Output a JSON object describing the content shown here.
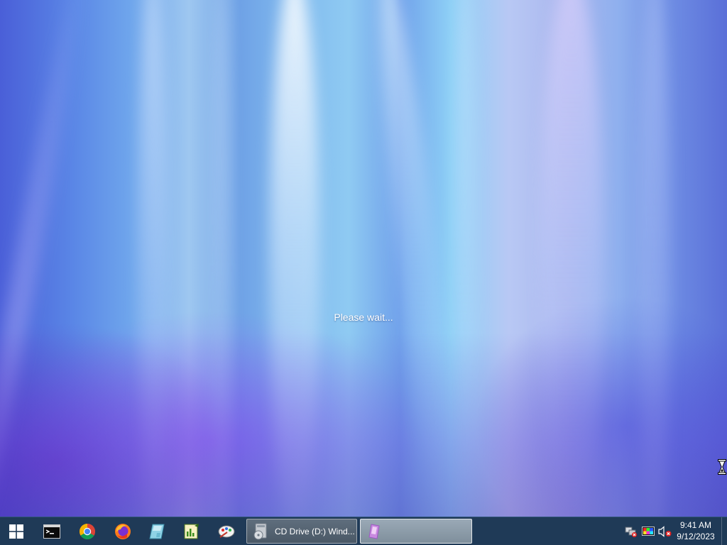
{
  "desktop": {
    "status_message": "Please wait..."
  },
  "taskbar": {
    "start_icon": "windows-logo-icon",
    "pinned": [
      {
        "name": "command-prompt",
        "icon": "terminal-icon"
      },
      {
        "name": "google-chrome",
        "icon": "chrome-icon"
      },
      {
        "name": "firefox",
        "icon": "firefox-icon"
      },
      {
        "name": "app-4",
        "icon": "glass-panel-icon"
      },
      {
        "name": "app-5",
        "icon": "chart-notepad-icon"
      },
      {
        "name": "app-6",
        "icon": "paint-palette-icon"
      }
    ],
    "tasks": [
      {
        "label": "CD Drive (D:) Wind...",
        "icon": "cd-drive-icon",
        "active": false
      },
      {
        "label": "",
        "icon": "media-player-icon",
        "active": true
      }
    ],
    "tray": {
      "icons": [
        "network-error-icon",
        "display-color-icon",
        "volume-muted-icon"
      ],
      "time": "9:41 AM",
      "date": "9/12/2023"
    }
  },
  "colors": {
    "taskbar_bg": "#1f3a57",
    "text": "#ffffff"
  }
}
